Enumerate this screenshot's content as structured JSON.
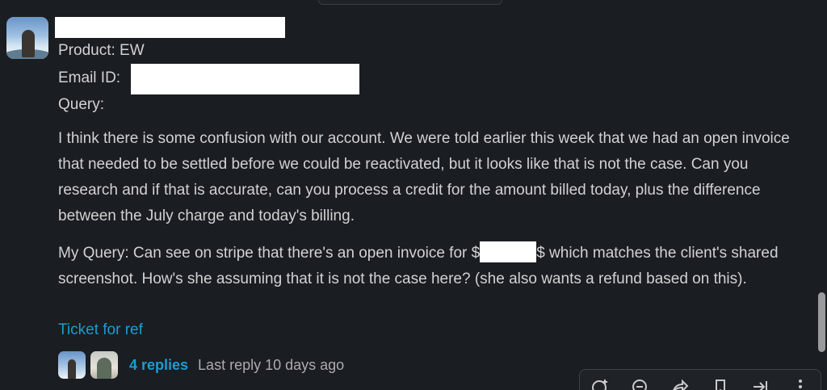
{
  "message": {
    "product_line": "Product: EW",
    "email_label": "Email ID:",
    "query_label": "Query:",
    "query_body": "I think there is some confusion with our account.  We were told earlier this week that we had an open invoice that needed to be settled before we could be reactivated, but it looks like that is not the case.  Can you research and if that is accurate, can you process a credit for the amount billed today, plus the difference between the July charge and today's billing.",
    "my_query_prefix": "My Query: Can see on stripe that there's an open invoice for $",
    "my_query_suffix": "$ which matches the client's shared screenshot. How's she assuming that it is not the case here? (she also wants a refund based on this).",
    "ticket_link": "Ticket for ref"
  },
  "thread": {
    "replies": "4 replies",
    "last_reply": "Last reply 10 days ago"
  },
  "toolbar": {
    "icons": [
      "add-reaction-icon",
      "reply-in-thread-icon",
      "share-icon",
      "bookmark-icon",
      "forward-icon",
      "more-icon"
    ]
  },
  "colors": {
    "background": "#1a1d21",
    "text": "#d1d2d3",
    "link": "#1d9bd1",
    "muted": "#abacae"
  }
}
